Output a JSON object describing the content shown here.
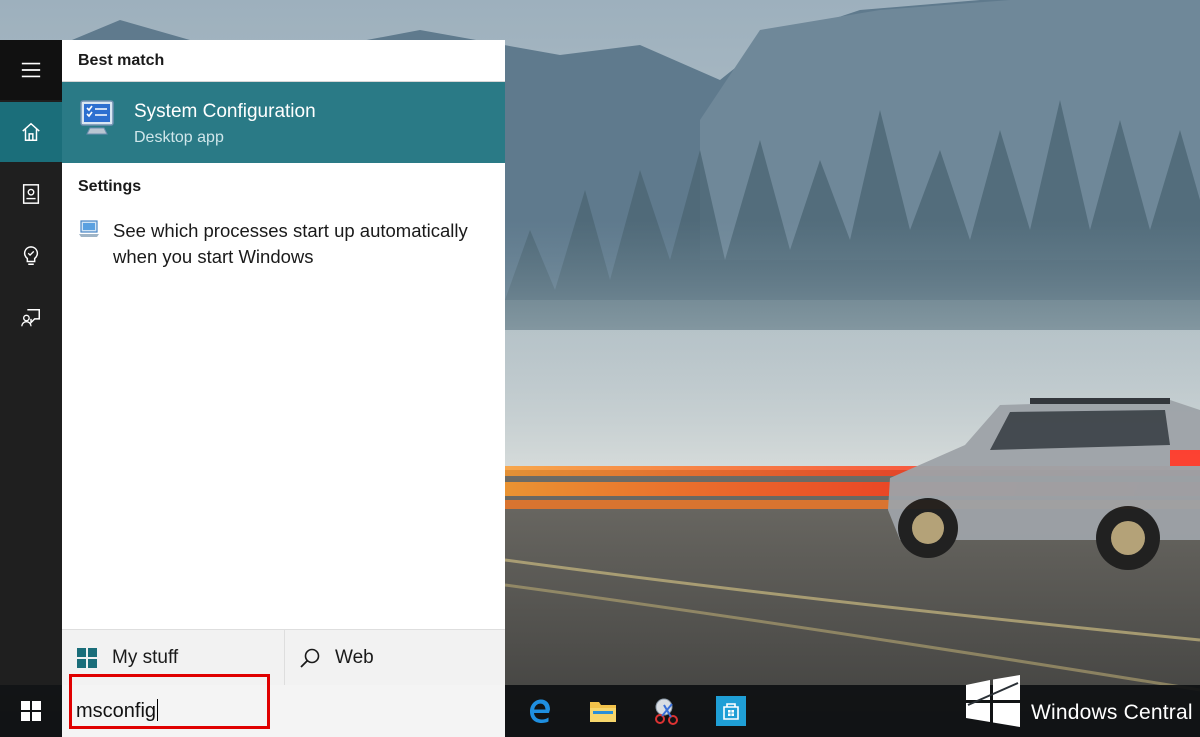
{
  "search_panel": {
    "best_match_heading": "Best match",
    "best_match": {
      "title": "System Configuration",
      "subtitle": "Desktop app",
      "icon": "system-configuration-icon"
    },
    "settings_heading": "Settings",
    "settings_item": {
      "text": "See which processes start up automatically when you start Windows",
      "icon": "pc-settings-icon"
    },
    "tabs": [
      {
        "label": "My stuff",
        "icon": "windows-logo-icon"
      },
      {
        "label": "Web",
        "icon": "search-icon"
      }
    ]
  },
  "nav_rail": {
    "items": [
      "hamburger-menu-icon",
      "home-icon",
      "notebook-icon",
      "reminders-icon",
      "feedback-icon"
    ]
  },
  "taskbar": {
    "search_value": "msconfig",
    "apps": [
      "edge-icon",
      "file-explorer-icon",
      "snipping-tool-icon",
      "store-icon"
    ]
  },
  "watermark": {
    "text": "Windows Central"
  },
  "colors": {
    "accent": "#2a7a86",
    "rail": "#1f1f1f",
    "highlight": "#e00000"
  }
}
